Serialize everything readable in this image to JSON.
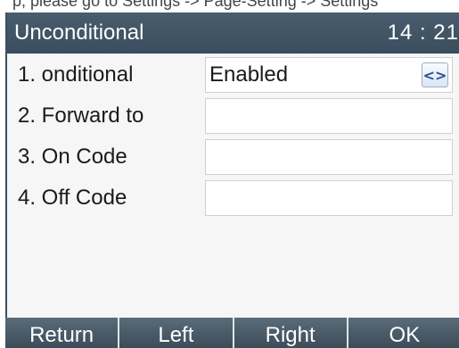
{
  "header_strip": {
    "text": "p, please go to Settings -> Page-Setting -> Settings"
  },
  "titlebar": {
    "title": "Unconditional",
    "time": "14 : 21"
  },
  "rows": [
    {
      "label": "1. onditional",
      "value": "Enabled",
      "control": "switch"
    },
    {
      "label": "2. Forward to",
      "value": ""
    },
    {
      "label": "3. On Code",
      "value": ""
    },
    {
      "label": "4. Off Code",
      "value": ""
    }
  ],
  "switch_icon": "left-right-arrows-icon",
  "switch_glyph": "<>",
  "softkeys": [
    "Return",
    "Left",
    "Right",
    "OK"
  ],
  "colors": {
    "titlebar": "#3f5263",
    "softkey": "#4a5a68",
    "switch_accent": "#2a4a9a"
  }
}
